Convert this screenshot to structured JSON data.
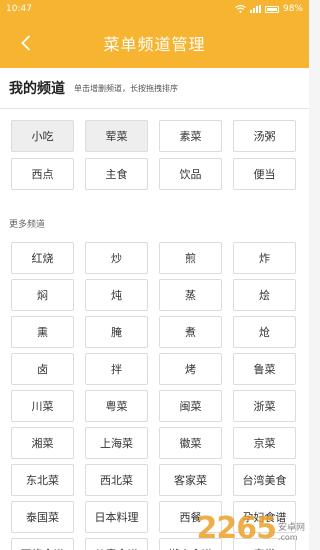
{
  "status": {
    "time": "10:47",
    "battery": "98%"
  },
  "appbar": {
    "title": "菜单频道管理"
  },
  "my_channels": {
    "heading": "我的频道",
    "hint": "单击增删频道，长按拖拽排序",
    "items": [
      "小吃",
      "荤菜",
      "素菜",
      "汤粥",
      "西点",
      "主食",
      "饮品",
      "便当"
    ]
  },
  "more_channels": {
    "heading": "更多频道",
    "items": [
      "红烧",
      "炒",
      "煎",
      "炸",
      "焖",
      "炖",
      "蒸",
      "烩",
      "熏",
      "腌",
      "煮",
      "炝",
      "卤",
      "拌",
      "烤",
      "鲁菜",
      "川菜",
      "粤菜",
      "闽菜",
      "浙菜",
      "湘菜",
      "上海菜",
      "徽菜",
      "京菜",
      "东北菜",
      "西北菜",
      "客家菜",
      "台湾美食",
      "泰国菜",
      "日本料理",
      "西餐",
      "孕妇食谱",
      "网络食谱",
      "儿童食谱",
      "懒人食谱",
      "家常"
    ]
  },
  "watermark": {
    "number": "2265",
    "text": "安卓网",
    "url": ".com"
  },
  "colors": {
    "accent": "#f6b431"
  }
}
